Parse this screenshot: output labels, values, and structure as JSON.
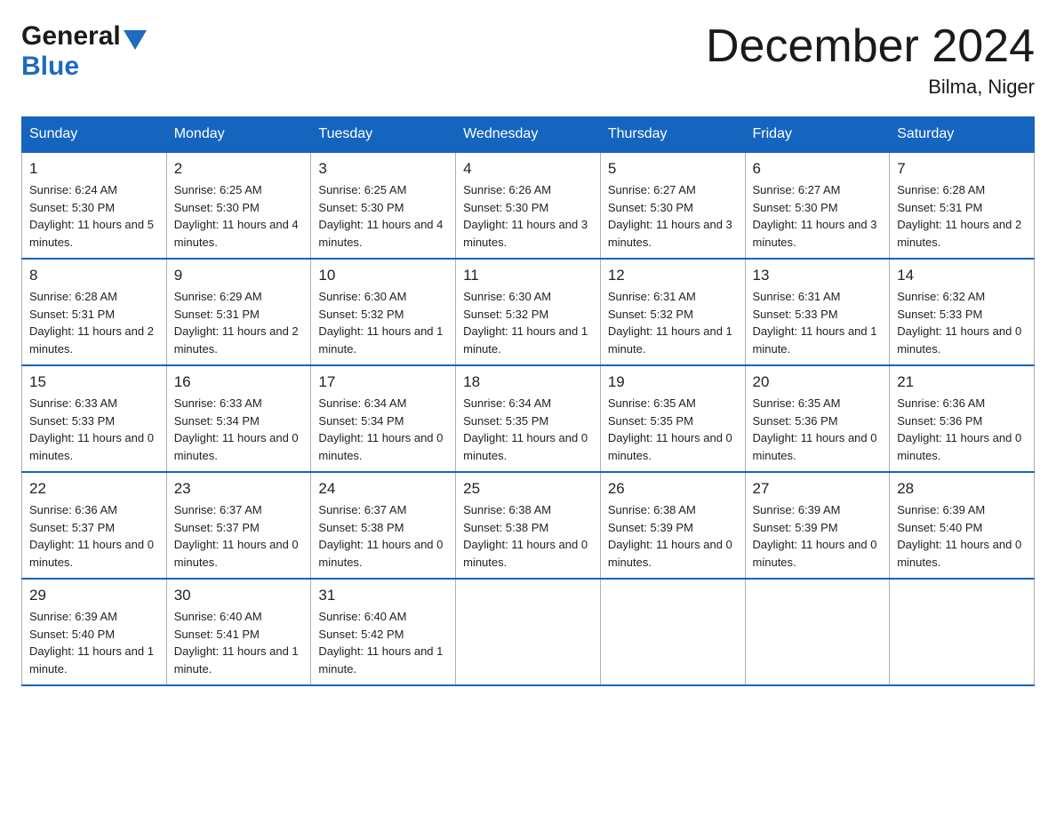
{
  "logo": {
    "general": "General",
    "blue": "Blue"
  },
  "title": {
    "month_year": "December 2024",
    "location": "Bilma, Niger"
  },
  "headers": [
    "Sunday",
    "Monday",
    "Tuesday",
    "Wednesday",
    "Thursday",
    "Friday",
    "Saturday"
  ],
  "weeks": [
    [
      {
        "day": "1",
        "sunrise": "6:24 AM",
        "sunset": "5:30 PM",
        "daylight": "11 hours and 5 minutes."
      },
      {
        "day": "2",
        "sunrise": "6:25 AM",
        "sunset": "5:30 PM",
        "daylight": "11 hours and 4 minutes."
      },
      {
        "day": "3",
        "sunrise": "6:25 AM",
        "sunset": "5:30 PM",
        "daylight": "11 hours and 4 minutes."
      },
      {
        "day": "4",
        "sunrise": "6:26 AM",
        "sunset": "5:30 PM",
        "daylight": "11 hours and 3 minutes."
      },
      {
        "day": "5",
        "sunrise": "6:27 AM",
        "sunset": "5:30 PM",
        "daylight": "11 hours and 3 minutes."
      },
      {
        "day": "6",
        "sunrise": "6:27 AM",
        "sunset": "5:30 PM",
        "daylight": "11 hours and 3 minutes."
      },
      {
        "day": "7",
        "sunrise": "6:28 AM",
        "sunset": "5:31 PM",
        "daylight": "11 hours and 2 minutes."
      }
    ],
    [
      {
        "day": "8",
        "sunrise": "6:28 AM",
        "sunset": "5:31 PM",
        "daylight": "11 hours and 2 minutes."
      },
      {
        "day": "9",
        "sunrise": "6:29 AM",
        "sunset": "5:31 PM",
        "daylight": "11 hours and 2 minutes."
      },
      {
        "day": "10",
        "sunrise": "6:30 AM",
        "sunset": "5:32 PM",
        "daylight": "11 hours and 1 minute."
      },
      {
        "day": "11",
        "sunrise": "6:30 AM",
        "sunset": "5:32 PM",
        "daylight": "11 hours and 1 minute."
      },
      {
        "day": "12",
        "sunrise": "6:31 AM",
        "sunset": "5:32 PM",
        "daylight": "11 hours and 1 minute."
      },
      {
        "day": "13",
        "sunrise": "6:31 AM",
        "sunset": "5:33 PM",
        "daylight": "11 hours and 1 minute."
      },
      {
        "day": "14",
        "sunrise": "6:32 AM",
        "sunset": "5:33 PM",
        "daylight": "11 hours and 0 minutes."
      }
    ],
    [
      {
        "day": "15",
        "sunrise": "6:33 AM",
        "sunset": "5:33 PM",
        "daylight": "11 hours and 0 minutes."
      },
      {
        "day": "16",
        "sunrise": "6:33 AM",
        "sunset": "5:34 PM",
        "daylight": "11 hours and 0 minutes."
      },
      {
        "day": "17",
        "sunrise": "6:34 AM",
        "sunset": "5:34 PM",
        "daylight": "11 hours and 0 minutes."
      },
      {
        "day": "18",
        "sunrise": "6:34 AM",
        "sunset": "5:35 PM",
        "daylight": "11 hours and 0 minutes."
      },
      {
        "day": "19",
        "sunrise": "6:35 AM",
        "sunset": "5:35 PM",
        "daylight": "11 hours and 0 minutes."
      },
      {
        "day": "20",
        "sunrise": "6:35 AM",
        "sunset": "5:36 PM",
        "daylight": "11 hours and 0 minutes."
      },
      {
        "day": "21",
        "sunrise": "6:36 AM",
        "sunset": "5:36 PM",
        "daylight": "11 hours and 0 minutes."
      }
    ],
    [
      {
        "day": "22",
        "sunrise": "6:36 AM",
        "sunset": "5:37 PM",
        "daylight": "11 hours and 0 minutes."
      },
      {
        "day": "23",
        "sunrise": "6:37 AM",
        "sunset": "5:37 PM",
        "daylight": "11 hours and 0 minutes."
      },
      {
        "day": "24",
        "sunrise": "6:37 AM",
        "sunset": "5:38 PM",
        "daylight": "11 hours and 0 minutes."
      },
      {
        "day": "25",
        "sunrise": "6:38 AM",
        "sunset": "5:38 PM",
        "daylight": "11 hours and 0 minutes."
      },
      {
        "day": "26",
        "sunrise": "6:38 AM",
        "sunset": "5:39 PM",
        "daylight": "11 hours and 0 minutes."
      },
      {
        "day": "27",
        "sunrise": "6:39 AM",
        "sunset": "5:39 PM",
        "daylight": "11 hours and 0 minutes."
      },
      {
        "day": "28",
        "sunrise": "6:39 AM",
        "sunset": "5:40 PM",
        "daylight": "11 hours and 0 minutes."
      }
    ],
    [
      {
        "day": "29",
        "sunrise": "6:39 AM",
        "sunset": "5:40 PM",
        "daylight": "11 hours and 1 minute."
      },
      {
        "day": "30",
        "sunrise": "6:40 AM",
        "sunset": "5:41 PM",
        "daylight": "11 hours and 1 minute."
      },
      {
        "day": "31",
        "sunrise": "6:40 AM",
        "sunset": "5:42 PM",
        "daylight": "11 hours and 1 minute."
      },
      null,
      null,
      null,
      null
    ]
  ]
}
